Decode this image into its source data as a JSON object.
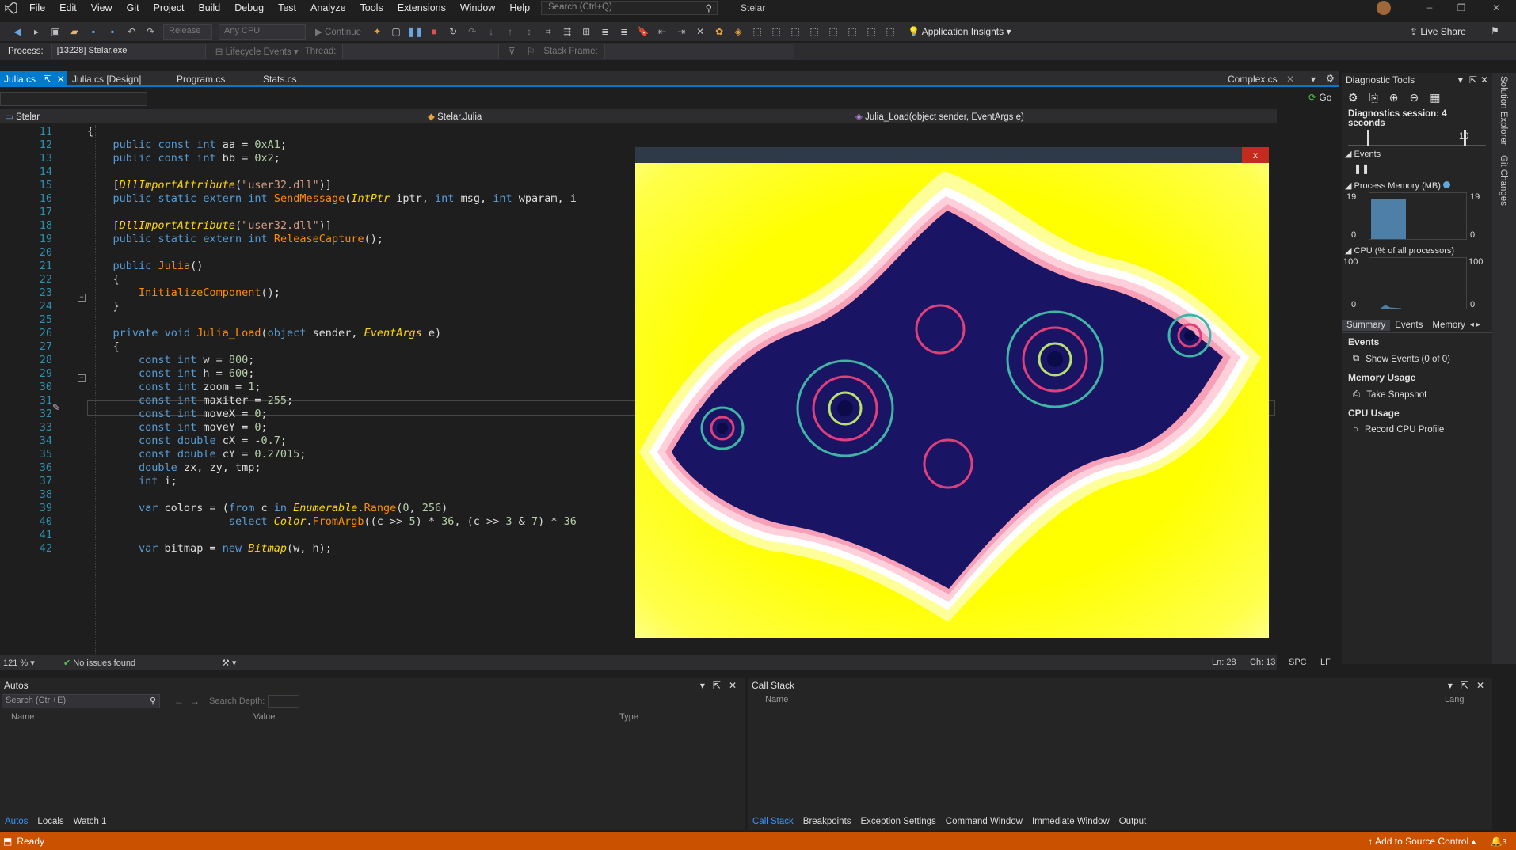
{
  "menu": [
    "File",
    "Edit",
    "View",
    "Git",
    "Project",
    "Build",
    "Debug",
    "Test",
    "Analyze",
    "Tools",
    "Extensions",
    "Window",
    "Help"
  ],
  "search_placeholder": "Search (Ctrl+Q)",
  "solution_name": "Stelar",
  "toolbar": {
    "config": "Release",
    "platform": "Any CPU",
    "continue": "Continue",
    "app_insights": "Application Insights",
    "live_share": "Live Share"
  },
  "debugbar": {
    "process_label": "Process:",
    "process_value": "[13228] Stelar.exe",
    "lifecycle": "Lifecycle Events",
    "thread_label": "Thread:",
    "stack_frame_label": "Stack Frame:"
  },
  "tabs": [
    {
      "label": "Julia.cs"
    },
    {
      "label": "Julia.cs [Design]"
    },
    {
      "label": "Program.cs"
    },
    {
      "label": "Stats.cs"
    },
    {
      "label": "Complex.cs"
    }
  ],
  "go": "Go",
  "nav": {
    "project": "Stelar",
    "class": "Stelar.Julia",
    "member": "Julia_Load(object sender, EventArgs e)"
  },
  "line_numbers": [
    "11",
    "12",
    "13",
    "14",
    "15",
    "16",
    "17",
    "18",
    "19",
    "20",
    "21",
    "22",
    "23",
    "24",
    "25",
    "26",
    "27",
    "28",
    "29",
    "30",
    "31",
    "32",
    "33",
    "34",
    "35",
    "36",
    "37",
    "38",
    "39",
    "40",
    "41",
    "42"
  ],
  "code_lines": [
    "{",
    "    public const int aa = 0xA1;",
    "    public const int bb = 0x2;",
    "",
    "    [DllImportAttribute(\"user32.dll\")]",
    "    public static extern int SendMessage(IntPtr iptr, int msg, int wparam, i",
    "",
    "    [DllImportAttribute(\"user32.dll\")]",
    "    public static extern int ReleaseCapture();",
    "",
    "    public Julia()",
    "    {",
    "        InitializeComponent();",
    "    }",
    "",
    "    private void Julia_Load(object sender, EventArgs e)",
    "    {",
    "        const int w = 800;",
    "        const int h = 600;",
    "        const int zoom = 1;",
    "        const int maxiter = 255;",
    "        const int moveX = 0;",
    "        const int moveY = 0;",
    "        const double cX = -0.7;",
    "        const double cY = 0.27015;",
    "        double zx, zy, tmp;",
    "        int i;",
    "",
    "        var colors = (from c in Enumerable.Range(0, 256)",
    "                      select Color.FromArgb((c >> 5) * 36, (c >> 3 & 7) * 36",
    "",
    "        var bitmap = new Bitmap(w, h);"
  ],
  "popup_close": "x",
  "editor_status": {
    "zoom": "121 %",
    "issues": "No issues found",
    "ln": "Ln: 28",
    "ch": "Ch: 13",
    "spc": "SPC",
    "lf": "LF"
  },
  "diagnostics": {
    "title": "Diagnostic Tools",
    "session": "Diagnostics session: 4 seconds",
    "timeline_mark": "10",
    "events_label": "Events",
    "memory_label": "Process Memory (MB)",
    "memory_max_left": "19",
    "memory_max_right": "19",
    "memory_min_left": "0",
    "memory_min_right": "0",
    "memory_level": 0.88,
    "cpu_label": "CPU (% of all processors)",
    "cpu_max_left": "100",
    "cpu_max_right": "100",
    "cpu_min_left": "0",
    "cpu_min_right": "0",
    "tabs": [
      "Summary",
      "Events",
      "Memory"
    ],
    "events_section": "Events",
    "show_events": "Show Events (0 of 0)",
    "memory_section": "Memory Usage",
    "take_snapshot": "Take Snapshot",
    "cpu_section": "CPU Usage",
    "record_cpu": "Record CPU Profile"
  },
  "side_tabs": [
    "Solution Explorer",
    "Git Changes"
  ],
  "autos": {
    "title": "Autos",
    "search_placeholder": "Search (Ctrl+E)",
    "search_depth": "Search Depth:",
    "col_name": "Name",
    "col_value": "Value",
    "col_type": "Type",
    "tabs": [
      "Autos",
      "Locals",
      "Watch 1"
    ]
  },
  "callstack": {
    "title": "Call Stack",
    "col_name": "Name",
    "col_lang": "Lang",
    "tabs": [
      "Call Stack",
      "Breakpoints",
      "Exception Settings",
      "Command Window",
      "Immediate Window",
      "Output"
    ]
  },
  "status": {
    "ready": "Ready",
    "source_control": "Add to Source Control",
    "notifications": "3"
  },
  "colors": {
    "accent": "#007acc",
    "statusbar": "#ca5100",
    "fractal_bg": "#ffff00",
    "fractal_core": "#0b0b4a"
  }
}
